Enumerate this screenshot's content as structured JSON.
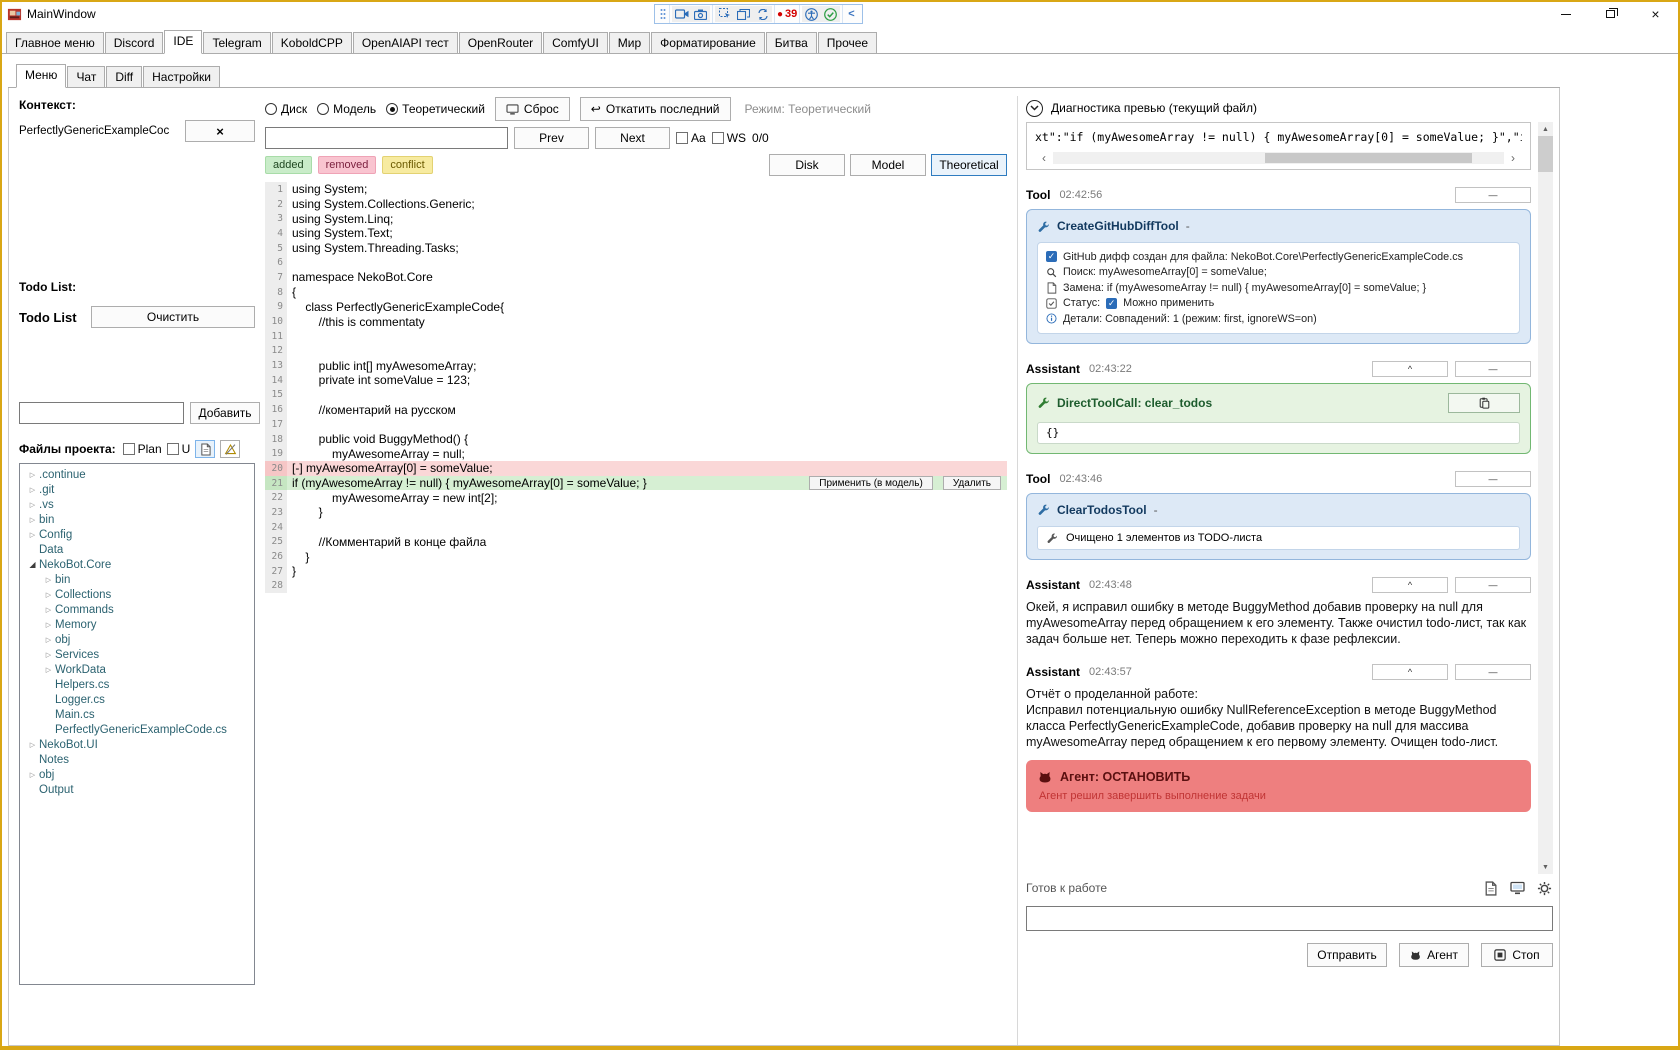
{
  "titlebar": {
    "title": "MainWindow",
    "rec_counter": "39"
  },
  "icons": {
    "close": "×",
    "minimize": "—",
    "collapse": "^",
    "prev_arrow": "‹",
    "next_arrow": "›",
    "up_arrow": "▲",
    "down_arrow": "▼",
    "tree_collapsed": "▷",
    "tree_expanded": "◢",
    "swap": "⇄",
    "chevron_left": "<",
    "check": "✓",
    "dot": "●",
    "revert": "↩",
    "reset": "↺"
  },
  "main_tabs": {
    "active_index": 2,
    "items": [
      "Главное меню",
      "Discord",
      "IDE",
      "Telegram",
      "KoboldCPP",
      "OpenAIAPI тест",
      "OpenRouter",
      "ComfyUI",
      "Мир",
      "Форматирование",
      "Битва",
      "Прочее"
    ]
  },
  "sub_tabs": {
    "active_index": 0,
    "items": [
      "Меню",
      "Чат",
      "Diff",
      "Настройки"
    ]
  },
  "left": {
    "context_label": "Контекст:",
    "context_item": "PerfectlyGenericExampleCoc",
    "todo_header": "Todo List:",
    "todo_title": "Todo List",
    "clear_button": "Очистить",
    "add_button": "Добавить",
    "files_label": "Файлы проекта:",
    "plan_checkbox": "Plan",
    "u_checkbox": "U",
    "tree": [
      {
        "label": ".continue",
        "level": 0,
        "arrow": "collapsed"
      },
      {
        "label": ".git",
        "level": 0,
        "arrow": "collapsed"
      },
      {
        "label": ".vs",
        "level": 0,
        "arrow": "collapsed"
      },
      {
        "label": "bin",
        "level": 0,
        "arrow": "collapsed"
      },
      {
        "label": "Config",
        "level": 0,
        "arrow": "collapsed"
      },
      {
        "label": "Data",
        "level": 0,
        "arrow": "none"
      },
      {
        "label": "NekoBot.Core",
        "level": 0,
        "arrow": "expanded"
      },
      {
        "label": "bin",
        "level": 1,
        "arrow": "collapsed"
      },
      {
        "label": "Collections",
        "level": 1,
        "arrow": "collapsed"
      },
      {
        "label": "Commands",
        "level": 1,
        "arrow": "collapsed"
      },
      {
        "label": "Memory",
        "level": 1,
        "arrow": "collapsed"
      },
      {
        "label": "obj",
        "level": 1,
        "arrow": "collapsed"
      },
      {
        "label": "Services",
        "level": 1,
        "arrow": "collapsed"
      },
      {
        "label": "WorkData",
        "level": 1,
        "arrow": "collapsed"
      },
      {
        "label": "Helpers.cs",
        "level": 1,
        "arrow": "none"
      },
      {
        "label": "Logger.cs",
        "level": 1,
        "arrow": "none"
      },
      {
        "label": "Main.cs",
        "level": 1,
        "arrow": "none"
      },
      {
        "label": "PerfectlyGenericExampleCode.cs",
        "level": 1,
        "arrow": "none"
      },
      {
        "label": "NekoBot.UI",
        "level": 0,
        "arrow": "collapsed"
      },
      {
        "label": "Notes",
        "level": 0,
        "arrow": "none"
      },
      {
        "label": "obj",
        "level": 0,
        "arrow": "collapsed"
      },
      {
        "label": "Output",
        "level": 0,
        "arrow": "none"
      }
    ]
  },
  "editor": {
    "radios": {
      "disk": "Диск",
      "model": "Модель",
      "theoretical": "Теоретический"
    },
    "reset_button": "Сброс",
    "revert_button": "Откатить последний",
    "mode_label": "Режим: Теоретический",
    "search_value": "",
    "prev_button": "Prev",
    "next_button": "Next",
    "aa_label": "Aa",
    "ws_label": "WS",
    "match_counter": "0/0",
    "legend": {
      "added": "added",
      "removed": "removed",
      "conflict": "conflict"
    },
    "view_buttons": {
      "disk": "Disk",
      "model": "Model",
      "theoretical": "Theoretical"
    },
    "apply_button": "Применить (в модель)",
    "delete_button": "Удалить",
    "lines": [
      {
        "n": 1,
        "text": "using System;"
      },
      {
        "n": 2,
        "text": "using System.Collections.Generic;"
      },
      {
        "n": 3,
        "text": "using System.Linq;"
      },
      {
        "n": 4,
        "text": "using System.Text;"
      },
      {
        "n": 5,
        "text": "using System.Threading.Tasks;"
      },
      {
        "n": 6,
        "text": ""
      },
      {
        "n": 7,
        "text": "namespace NekoBot.Core"
      },
      {
        "n": 8,
        "text": "{"
      },
      {
        "n": 9,
        "text": "    class PerfectlyGenericExampleCode{"
      },
      {
        "n": 10,
        "text": "        //this is commentaty"
      },
      {
        "n": 11,
        "text": ""
      },
      {
        "n": 12,
        "text": ""
      },
      {
        "n": 13,
        "text": "        public int[] myAwesomeArray;"
      },
      {
        "n": 14,
        "text": "        private int someValue = 123;"
      },
      {
        "n": 15,
        "text": ""
      },
      {
        "n": 16,
        "text": "        //коментарий на русском"
      },
      {
        "n": 17,
        "text": ""
      },
      {
        "n": 18,
        "text": "        public void BuggyMethod() {"
      },
      {
        "n": 19,
        "text": "            myAwesomeArray = null;"
      },
      {
        "n": 20,
        "text": "[-] myAwesomeArray[0] = someValue;",
        "type": "removed"
      },
      {
        "n": 21,
        "text": "if (myAwesomeArray != null) { myAwesomeArray[0] = someValue; }",
        "type": "added",
        "actions": true
      },
      {
        "n": 22,
        "text": "            myAwesomeArray = new int[2];"
      },
      {
        "n": 23,
        "text": "        }"
      },
      {
        "n": 24,
        "text": ""
      },
      {
        "n": 25,
        "text": "        //Комментарий в конце файла"
      },
      {
        "n": 26,
        "text": "    }"
      },
      {
        "n": 27,
        "text": "}"
      },
      {
        "n": 28,
        "text": ""
      }
    ]
  },
  "diagnostics": {
    "header": "Диагностика превью (текущий файл)",
    "preview_text": "xt\":\"if (myAwesomeArray != null) { myAwesomeArray[0] = someValue; }\",\"ignorewhitespace",
    "tool1": {
      "role": "Tool",
      "time": "02:42:56",
      "title": "CreateGitHubDiffTool",
      "dash": "-",
      "created": "GitHub дифф создан для файла: NekoBot.Core\\PerfectlyGenericExampleCode.cs",
      "search": "Поиск: myAwesomeArray[0] = someValue;",
      "replace": "Замена: if (myAwesomeArray != null) { myAwesomeArray[0] = someValue; }",
      "status_prefix": "Статус:",
      "status_text": "Можно применить",
      "details": "Детали: Совпадений: 1 (режим: first, ignoreWS=on)"
    },
    "assistant1": {
      "role": "Assistant",
      "time": "02:43:22",
      "tool_call": "DirectToolCall: clear_todos",
      "payload": "{}"
    },
    "tool2": {
      "role": "Tool",
      "time": "02:43:46",
      "title": "ClearTodosTool",
      "dash": "-",
      "result": "Очищено 1 элементов из TODO-листа"
    },
    "assistant2": {
      "role": "Assistant",
      "time": "02:43:48",
      "text": "Окей, я исправил ошибку в методе BuggyMethod добавив проверку на null для myAwesomeArray перед обращением к его элементу. Также очистил todo-лист, так как задач больше нет. Теперь можно переходить к фазе рефлексии."
    },
    "assistant3": {
      "role": "Assistant",
      "time": "02:43:57",
      "report_title": "Отчёт о проделанной работе:",
      "report_body": "Исправил потенциальную ошибку NullReferenceException в методе BuggyMethod класса PerfectlyGenericExampleCode, добавив проверку на null для массива myAwesomeArray перед обращением к его первому элементу. Очищен todo-лист.",
      "alert_title": "Агент: ОСТАНОВИТЬ",
      "alert_sub": "Агент решил завершить выполнение задачи"
    },
    "status_text": "Готов к работе",
    "send_button": "Отправить",
    "agent_button": "Агент",
    "stop_button": "Стоп"
  }
}
